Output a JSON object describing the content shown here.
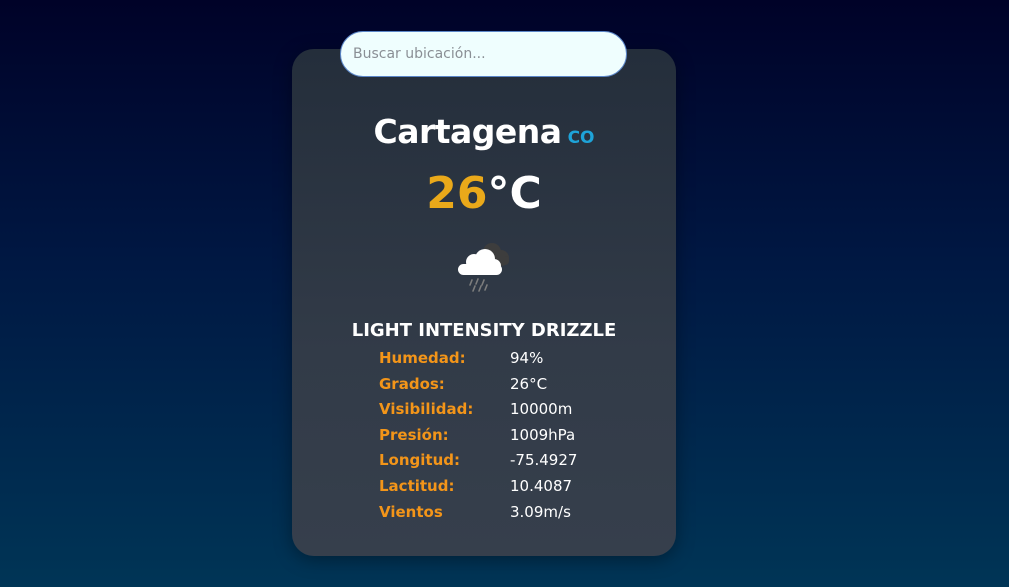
{
  "search": {
    "placeholder": "Buscar ubicación..."
  },
  "location": {
    "city": "Cartagena",
    "country_code": "CO"
  },
  "temperature": {
    "value": "26",
    "unit": "°C"
  },
  "weather": {
    "icon": "rain-cloud-icon",
    "description": "LIGHT INTENSITY DRIZZLE"
  },
  "details": [
    {
      "label": "Humedad:",
      "value": "94%"
    },
    {
      "label": "Grados:",
      "value": "26°C"
    },
    {
      "label": "Visibilidad:",
      "value": "10000m"
    },
    {
      "label": "Presión:",
      "value": "1009hPa"
    },
    {
      "label": "Longitud:",
      "value": "-75.4927"
    },
    {
      "label": "Lactitud:",
      "value": "10.4087"
    },
    {
      "label": "Vientos",
      "value": "3.09m/s"
    }
  ],
  "colors": {
    "temperature_accent": "#eaa91a",
    "label_accent": "#f39519",
    "country_accent": "#1ea3d8",
    "card_background": "#2c3542"
  }
}
